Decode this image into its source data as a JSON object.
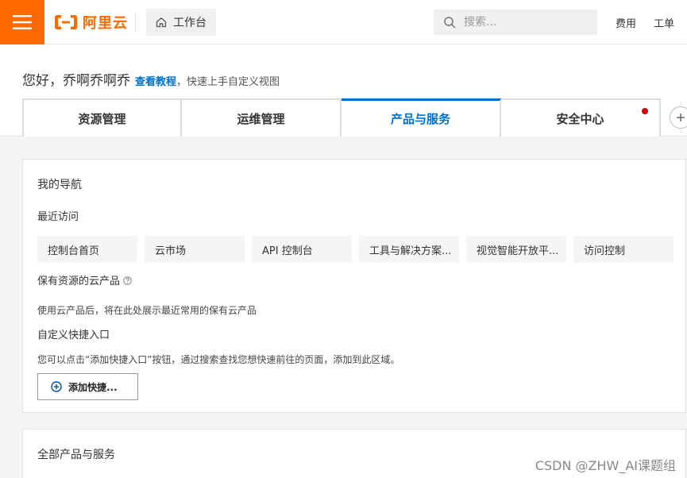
{
  "header": {
    "logo_text": "阿里云",
    "workbench_label": "工作台",
    "search_placeholder": "搜索...",
    "links": [
      "费用",
      "工单"
    ]
  },
  "hero": {
    "greeting": "您好，乔啊乔啊乔",
    "tutorial_link": "查看教程",
    "tip": "，快速上手自定义视图",
    "tabs": [
      {
        "label": "资源管理"
      },
      {
        "label": "运维管理"
      },
      {
        "label": "产品与服务",
        "active": true
      },
      {
        "label": "安全中心",
        "badge": true
      }
    ]
  },
  "nav_card": {
    "title": "我的导航",
    "recent_label": "最近访问",
    "recent_items": [
      "控制台首页",
      "云市场",
      "API 控制台",
      "工具与解决方案...",
      "视觉智能开放平...",
      "访问控制"
    ],
    "owned_label": "保有资源的云产品",
    "owned_desc": "使用云产品后，将在此处展示最近常用的保有云产品",
    "custom_label": "自定义快捷入口",
    "custom_desc": "您可以点击“添加快捷入口”按钮，通过搜索查找您想快速前往的页面，添加到此区域。",
    "add_button": "添加快捷..."
  },
  "all_card": {
    "title": "全部产品与服务"
  },
  "watermark": "CSDN @ZHW_AI课题组",
  "colors": {
    "brand": "#ff6a00",
    "accent": "#0070cc",
    "badge": "#d40000"
  }
}
